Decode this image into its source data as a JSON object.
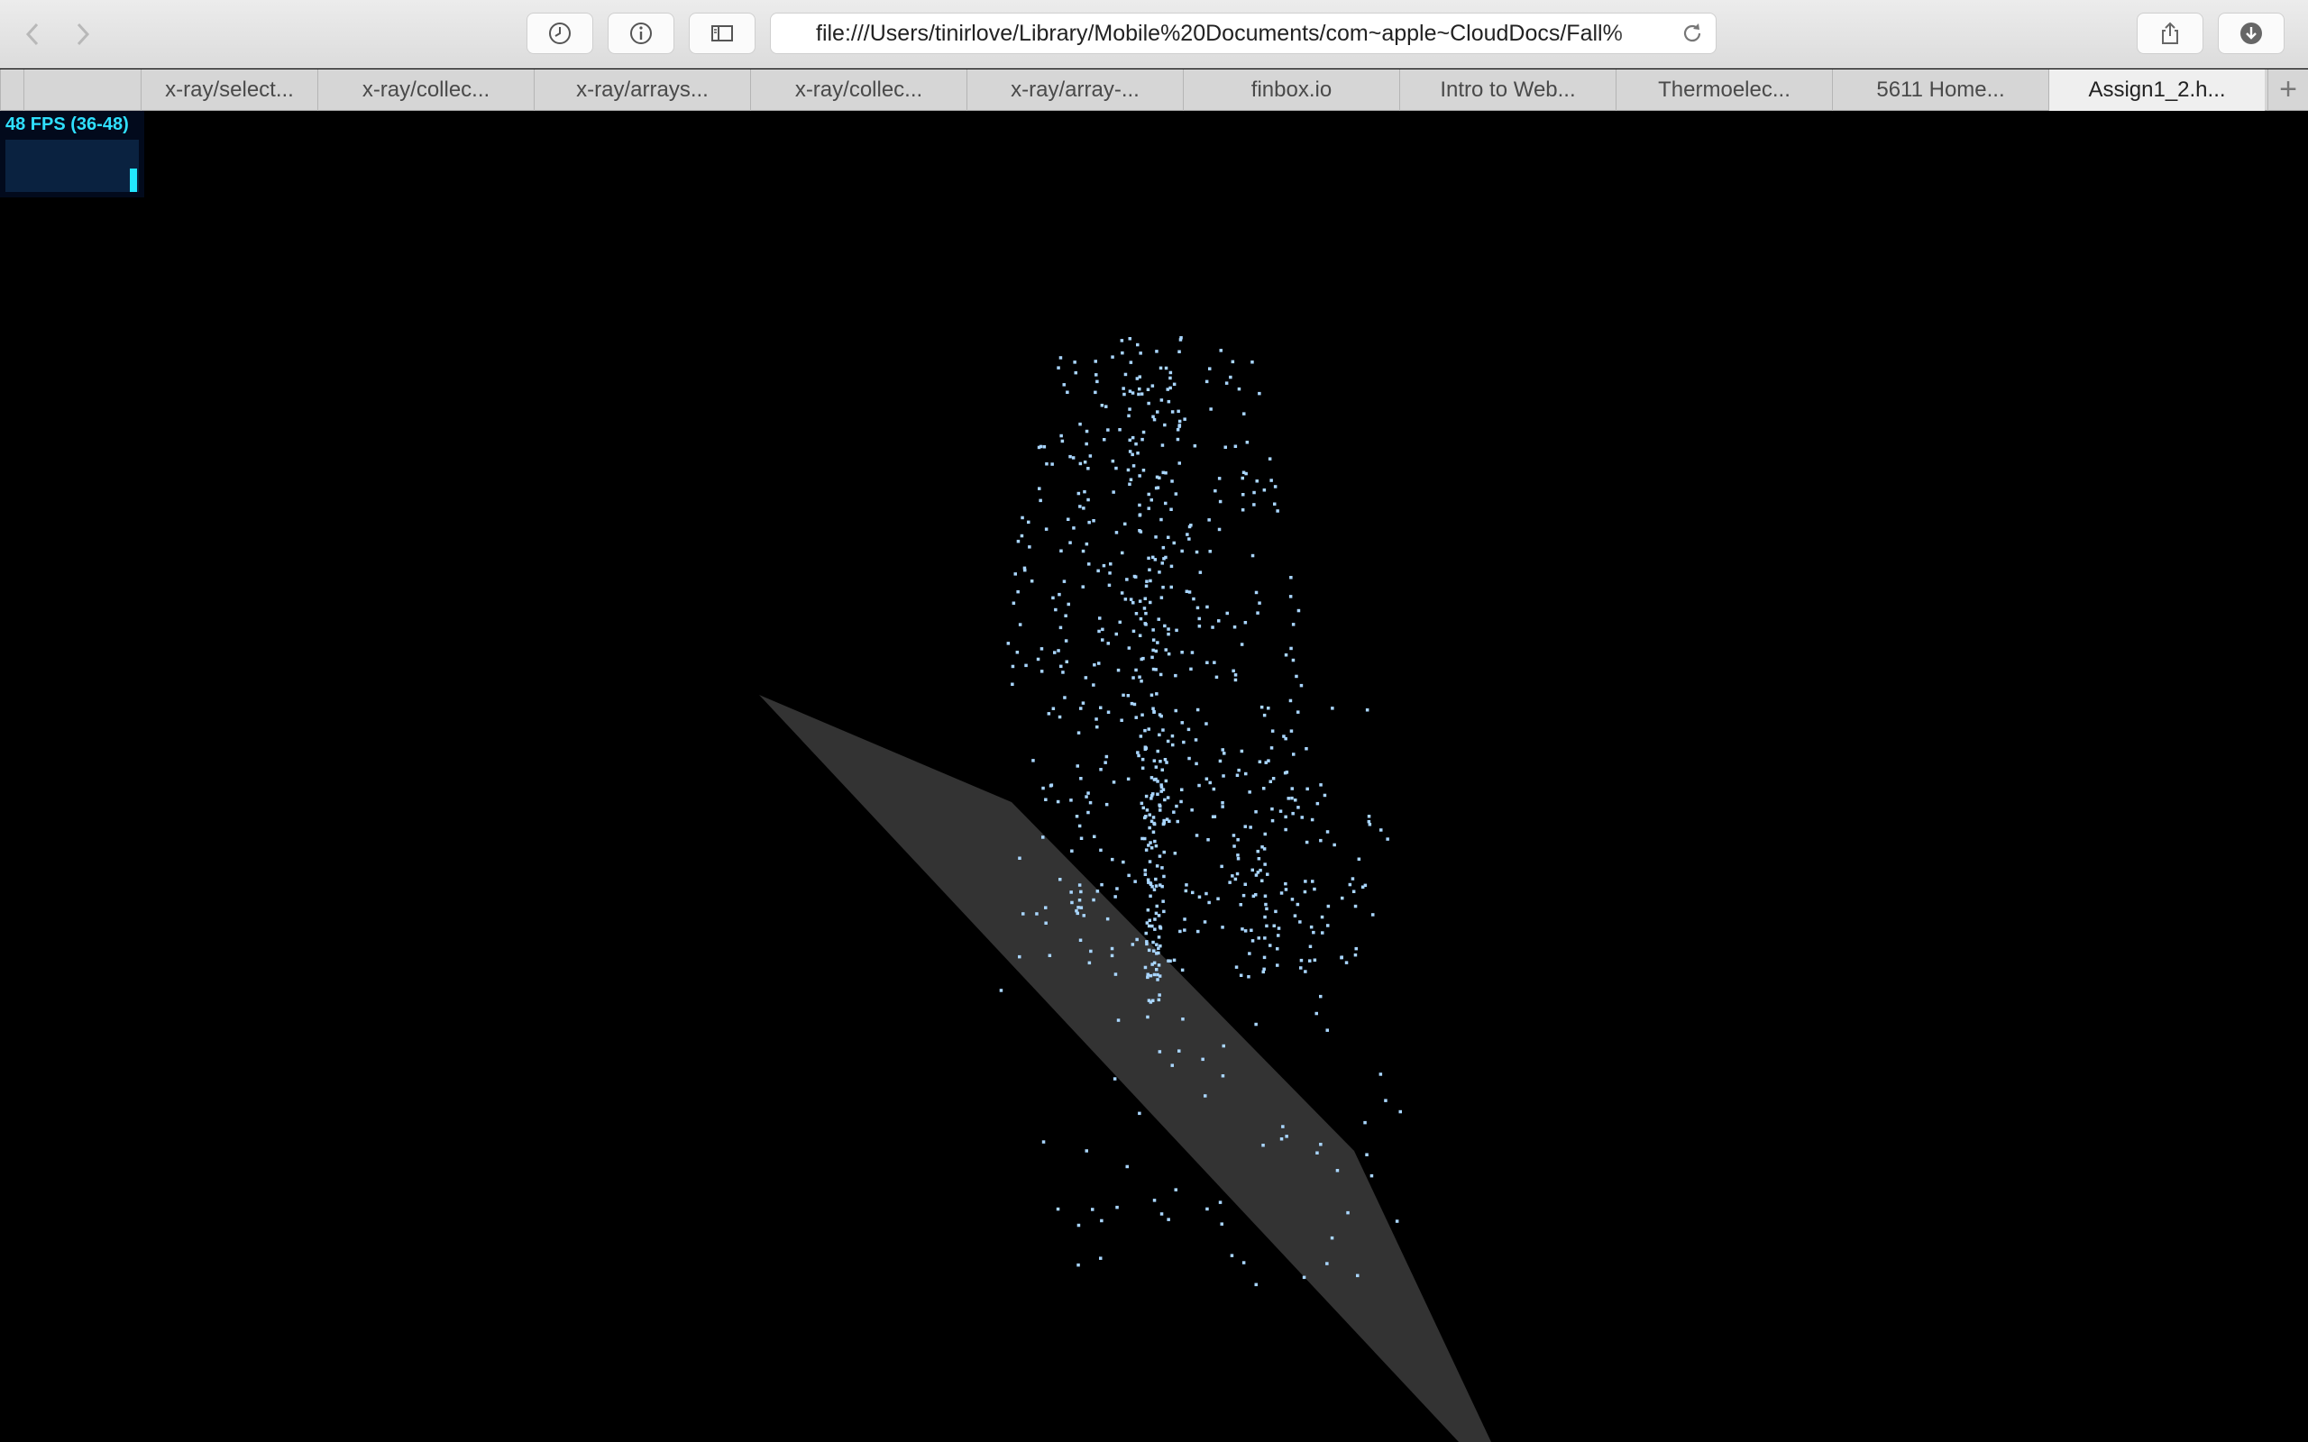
{
  "browser": {
    "nav": {
      "back_icon": "chevron-left-icon",
      "forward_icon": "chevron-right-icon"
    },
    "toolbar_icons": [
      "history-clock-icon",
      "info-icon",
      "sidebar-icon",
      "share-icon",
      "download-icon"
    ],
    "address": "file:///Users/tinirlove/Library/Mobile%20Documents/com~apple~CloudDocs/Fall%",
    "reload_icon": "reload-icon",
    "tabs": [
      {
        "label": "",
        "active": false
      },
      {
        "label": "",
        "active": false
      },
      {
        "label": "x-ray/select...",
        "active": false
      },
      {
        "label": "x-ray/collec...",
        "active": false
      },
      {
        "label": "x-ray/arrays...",
        "active": false
      },
      {
        "label": "x-ray/collec...",
        "active": false
      },
      {
        "label": "x-ray/array-...",
        "active": false
      },
      {
        "label": "finbox.io",
        "active": false
      },
      {
        "label": "Intro to Web...",
        "active": false
      },
      {
        "label": "Thermoelec...",
        "active": false
      },
      {
        "label": "5611 Home...",
        "active": false
      },
      {
        "label": "Assign1_2.h...",
        "active": true
      }
    ],
    "new_tab_label": "+"
  },
  "stats": {
    "fps_text": "48 FPS (36-48)",
    "fps_value": 48,
    "fps_min": 36,
    "fps_max": 48
  },
  "colors": {
    "background": "#000000",
    "particle": "#a9d6ff",
    "plane": "#333333",
    "fps_text": "#2fe0ff",
    "fps_bar": "#22e6ff"
  },
  "scene": {
    "description_objects": [
      "particle-fountain",
      "ground-plane"
    ]
  }
}
